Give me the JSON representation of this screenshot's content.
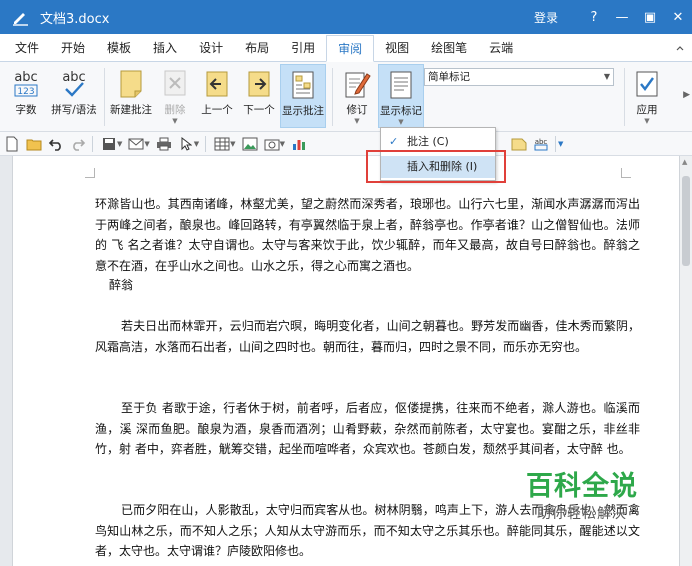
{
  "titlebar": {
    "doc_title": "文档3.docx",
    "login": "登录",
    "help": "?",
    "minimize": "—",
    "restore": "▣",
    "close": "✕"
  },
  "tabs": [
    "文件",
    "开始",
    "模板",
    "插入",
    "设计",
    "布局",
    "引用",
    "审阅",
    "视图",
    "绘图笔",
    "云端"
  ],
  "active_tab": "审阅",
  "ribbon": {
    "word_count": "字数",
    "spell_check": "拼写/语法",
    "new_comment": "新建批注",
    "delete": "删除",
    "prev": "上一个",
    "next": "下一个",
    "show_comments": "显示批注",
    "track": "修订",
    "show_markup": "显示标记",
    "markup_mode": "简单标记",
    "apply": "应用",
    "abc_label": "abc",
    "abc_num": "123"
  },
  "dropdown": {
    "comments": "批注 (C)",
    "insert_delete": "插入和删除 (I)"
  },
  "document": {
    "para1": "环滁皆山也。其西南诸峰，林壑尤美，望之蔚然而深秀者，琅琊也。山行六七里，渐闻水声潺潺而泻出于两峰之间者，酿泉也。峰回路转，有亭翼然临于泉上者，醉翁亭也。作亭者谁？山之僧智仙也。法师的 飞 名之者谁？太守自谓也。太守与客来饮于此，饮少辄醉，而年又最高，故自号曰醉翁也。醉翁之意不在酒，在乎山水之间也。山水之乐，得之心而寓之酒也。",
    "signer": "醉翁",
    "para2": "若夫日出而林霏开，云归而岩穴暝，晦明变化者，山间之朝暮也。野芳发而幽香，佳木秀而繁阴，风霜高洁，水落而石出者，山间之四时也。朝而往，暮而归，四时之景不同，而乐亦无穷也。",
    "para3": "至于负 者歌于途，行者休于树，前者呼，后者应，伛偻提携，往来而不绝者，滁人游也。临溪而渔，溪 深而鱼肥。酿泉为酒，泉香而酒冽；山肴野蔌，杂然而前陈者，太守宴也。宴酣之乐，非丝非竹，射 者中，弈者胜，觥筹交错，起坐而喧哗者，众宾欢也。苍颜白发，颓然乎其间者，太守醉 也。",
    "para4": "已而夕阳在山，人影散乱，太守归而宾客从也。树林阴翳，鸣声上下，游人去而禽鸟乐也。然而禽鸟知山林之乐，而不知人之乐；人知从太守游而乐，而不知太守之乐其乐也。醉能同其乐，醒能述以文者，太守也。太守谓谁？庐陵欧阳修也。"
  },
  "watermark": {
    "brand": "百科全说",
    "slogan": "助你轻松解决"
  },
  "colors": {
    "titlebar": "#2b78c5",
    "highlight": "#e0403a",
    "watermark_green": "#2ea84a"
  }
}
